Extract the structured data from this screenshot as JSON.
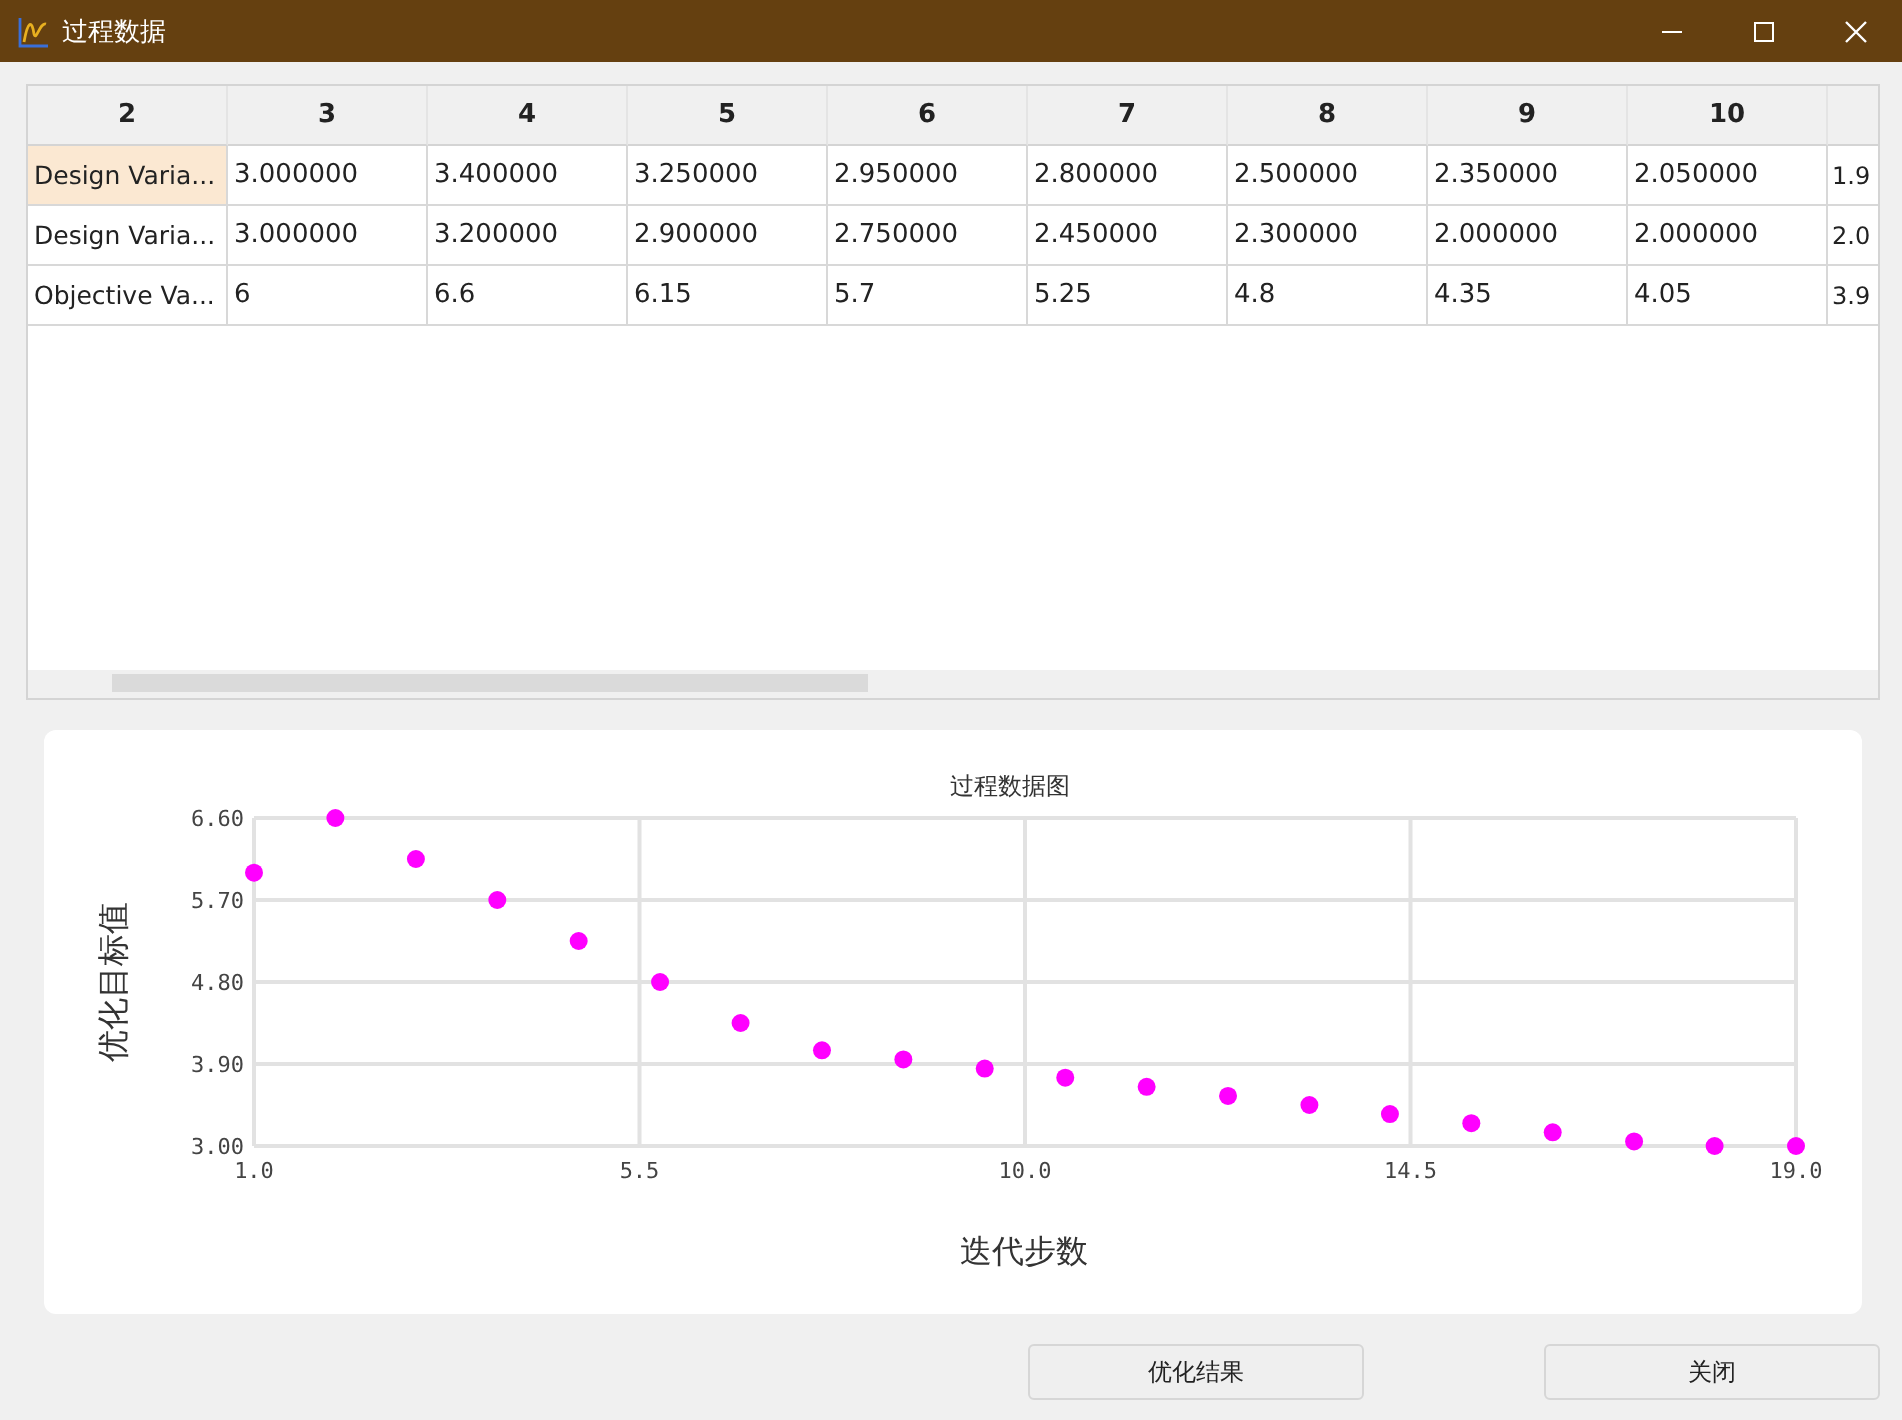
{
  "window": {
    "title": "过程数据"
  },
  "table": {
    "columns": [
      "2",
      "3",
      "4",
      "5",
      "6",
      "7",
      "8",
      "9",
      "10"
    ],
    "rows": [
      {
        "selected": true,
        "cells": [
          "Design Varia...",
          "3.000000",
          "3.400000",
          "3.250000",
          "2.950000",
          "2.800000",
          "2.500000",
          "2.350000",
          "2.050000",
          "1.9"
        ]
      },
      {
        "selected": false,
        "cells": [
          "Design Varia...",
          "3.000000",
          "3.200000",
          "2.900000",
          "2.750000",
          "2.450000",
          "2.300000",
          "2.000000",
          "2.000000",
          "2.0"
        ]
      },
      {
        "selected": false,
        "cells": [
          "Objective Va...",
          "6",
          "6.6",
          "6.15",
          "5.7",
          "5.25",
          "4.8",
          "4.35",
          "4.05",
          "3.9"
        ]
      }
    ]
  },
  "chart": {
    "chart_data": {
      "type": "scatter",
      "title": "过程数据图",
      "xlabel": "迭代步数",
      "ylabel": "优化目标值",
      "x": [
        1.0,
        1.95,
        2.89,
        3.84,
        4.79,
        5.74,
        6.68,
        7.63,
        8.58,
        9.53,
        10.47,
        11.42,
        12.37,
        13.32,
        14.26,
        15.21,
        16.16,
        17.11,
        18.05,
        19.0
      ],
      "grid": true,
      "series": [
        {
          "color": "#ff00ff",
          "values": [
            6,
            6.6,
            6.15,
            5.7,
            5.25,
            4.8,
            4.35,
            4.05,
            3.95,
            3.85,
            3.75,
            3.65,
            3.55,
            3.45,
            3.35,
            3.25,
            3.15,
            3.05,
            3.0,
            3.0
          ]
        }
      ],
      "xlim": [
        1.0,
        19.0
      ],
      "ylim": [
        3.0,
        6.6
      ],
      "xticks": [
        {
          "value": 1.0,
          "label": "1.0"
        },
        {
          "value": 5.5,
          "label": "5.5"
        },
        {
          "value": 10.0,
          "label": "10.0"
        },
        {
          "value": 14.5,
          "label": "14.5"
        },
        {
          "value": 19.0,
          "label": "19.0"
        }
      ],
      "yticks": [
        {
          "value": 3.0,
          "label": "3.00"
        },
        {
          "value": 3.9,
          "label": "3.90"
        },
        {
          "value": 4.8,
          "label": "4.80"
        },
        {
          "value": 5.7,
          "label": "5.70"
        },
        {
          "value": 6.6,
          "label": "6.60"
        }
      ]
    }
  },
  "buttons": [
    "优化结果",
    "关闭"
  ]
}
